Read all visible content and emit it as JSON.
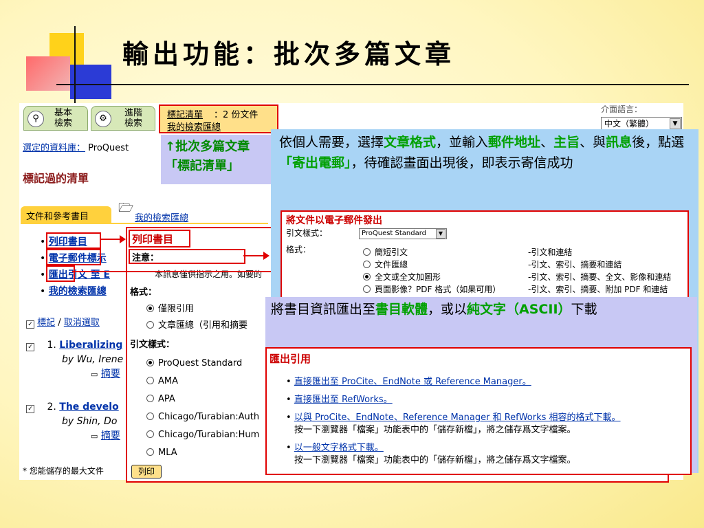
{
  "slide": {
    "title": "輸出功能：批次多篇文章"
  },
  "toolbar": {
    "basic_search": "基本\n檢索",
    "advanced_search": "進階\n檢索",
    "marked_list_label": "標記清單",
    "marked_count": "：2 份文件",
    "my_search_summary": "我的檢索匯總",
    "interface_language_label": "介面語言：",
    "interface_language_value": "中文（繁體）"
  },
  "page": {
    "db_label": "選定的資料庫：",
    "db_value": "ProQuest",
    "heading": "標記過的清單",
    "tab_docs": "文件和參考書目",
    "tab_summary": "我的檢索匯總",
    "bullets": [
      "列印書目",
      "電子郵件標示",
      "匯出引文 至 E",
      "我的檢索匯總"
    ],
    "mark_link": "標記",
    "clear_link": "取消選取",
    "results": [
      {
        "num": "1.",
        "title": "Liberalizing",
        "by": "by Wu, Irene",
        "abstract": "摘要"
      },
      {
        "num": "2.",
        "title": "The develo",
        "by": "by Shin, Do",
        "abstract": "摘要"
      }
    ],
    "footer_note": "* 您能儲存的最大文件"
  },
  "callout_batch": {
    "line1": "↑批次多篇文章",
    "line2": "「標記清單」"
  },
  "print_panel": {
    "title": "列印書目",
    "note_label": "注意：",
    "note_text": "本訊息僅供指示之用。如要的",
    "format_label": "格式：",
    "format_options": [
      "僅限引用",
      "文章匯總（引用和摘要"
    ],
    "style_label": "引文樣式：",
    "style_options": [
      "ProQuest Standard",
      "AMA",
      "APA",
      "Chicago/Turabian:Auth",
      "Chicago/Turabian:Hum",
      "MLA"
    ],
    "print_button": "列印"
  },
  "email_callout": {
    "text_parts": [
      "依個人需要，選擇",
      "文章格式",
      "，並輸入",
      "郵件地址",
      "、",
      "主旨",
      "、與",
      "訊息",
      "後，點選",
      "「寄出電郵」",
      "，待確認畫面出現後，即表示寄信成功"
    ]
  },
  "email_panel": {
    "title": "將文件以電子郵件發出",
    "style_label": "引文樣式：",
    "style_value": "ProQuest Standard",
    "format_label": "格式：",
    "options": [
      {
        "label": "簡短引文",
        "desc": "-引文和連結"
      },
      {
        "label": "文件匯總",
        "desc": "-引文、索引、摘要和連結"
      },
      {
        "label": "全文或全文加圖形",
        "desc": "-引文、索引、摘要、全文、影像和連結"
      },
      {
        "label": "頁面影像？PDF 格式（如果可用）",
        "desc": "-引文、索引、摘要、附加 PDF 和連結"
      }
    ]
  },
  "export_callout": {
    "text_parts": [
      "將書目資訊匯出至",
      "書目軟體",
      "，或以",
      "純文字（ASCII）",
      "下載"
    ]
  },
  "export_panel": {
    "title": "匯出引用",
    "items": [
      {
        "link_prefix": "直接匯出至",
        "link_rest": " ProCite、EndNote 或 Reference Manager。",
        "note": ""
      },
      {
        "link_prefix": "直接匯出至",
        "link_rest": " RefWorks。",
        "note": ""
      },
      {
        "link_prefix": "以與",
        "link_rest": " ProCite、EndNote、Reference Manager 和 RefWorks 相容的格式下載。",
        "note": "按一下瀏覽器「檔案」功能表中的「儲存新檔」，將之儲存爲文字檔案。"
      },
      {
        "link_prefix": "以一般文字格式下載。",
        "link_rest": "",
        "note": "按一下瀏覽器「檔案」功能表中的「儲存新檔」，將之儲存爲文字檔案。"
      }
    ]
  },
  "colors": {
    "accent_red": "#e00000",
    "callout_blue": "#a9d4f5",
    "callout_lavender": "#c8c8f4",
    "highlight_green": "#00a000"
  }
}
